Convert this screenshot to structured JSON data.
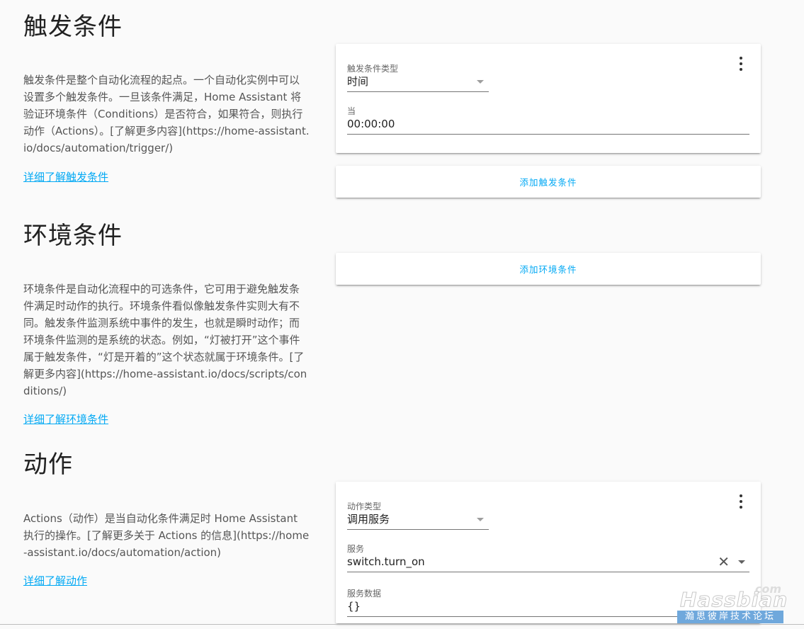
{
  "triggers": {
    "title": "触发条件",
    "description": "触发条件是整个自动化流程的起点。一个自动化实例中可以设置多个触发条件。一旦该条件满足，Home Assistant 将验证环境条件（Conditions）是否符合，如果符合，则执行动作（Actions）。[了解更多内容](https://home-assistant.io/docs/automation/trigger/)",
    "learn_more": "详细了解触发条件",
    "card": {
      "type_label": "触发条件类型",
      "type_value": "时间",
      "at_label": "当",
      "at_value": "00:00:00"
    },
    "add_button": "添加触发条件"
  },
  "conditions": {
    "title": "环境条件",
    "description": "环境条件是自动化流程中的可选条件，它可用于避免触发条件满足时动作的执行。环境条件看似像触发条件实则大有不同。触发条件监测系统中事件的发生，也就是瞬时动作；而环境条件监测的是系统的状态。例如，“灯被打开”这个事件属于触发条件，“灯是开着的”这个状态就属于环境条件。[了解更多内容](https://home-assistant.io/docs/scripts/conditions/)",
    "learn_more": "详细了解环境条件",
    "add_button": "添加环境条件"
  },
  "actions": {
    "title": "动作",
    "description": "Actions（动作）是当自动化条件满足时 Home Assistant 执行的操作。[了解更多关于 Actions 的信息](https://home-assistant.io/docs/automation/action)",
    "learn_more": "详细了解动作",
    "card": {
      "type_label": "动作类型",
      "type_value": "调用服务",
      "service_label": "服务",
      "service_value": "switch.turn_on",
      "data_label": "服务数据",
      "data_value": "{}"
    }
  },
  "watermark": {
    "com": "com",
    "name": "Hassbian",
    "tagline": "瀚思彼岸技术论坛"
  },
  "colors": {
    "accent": "#03a9f4",
    "background": "#fafafa",
    "card": "#ffffff"
  },
  "icons": [
    "more-vert-icon",
    "dropdown-arrow-icon",
    "clear-icon"
  ]
}
